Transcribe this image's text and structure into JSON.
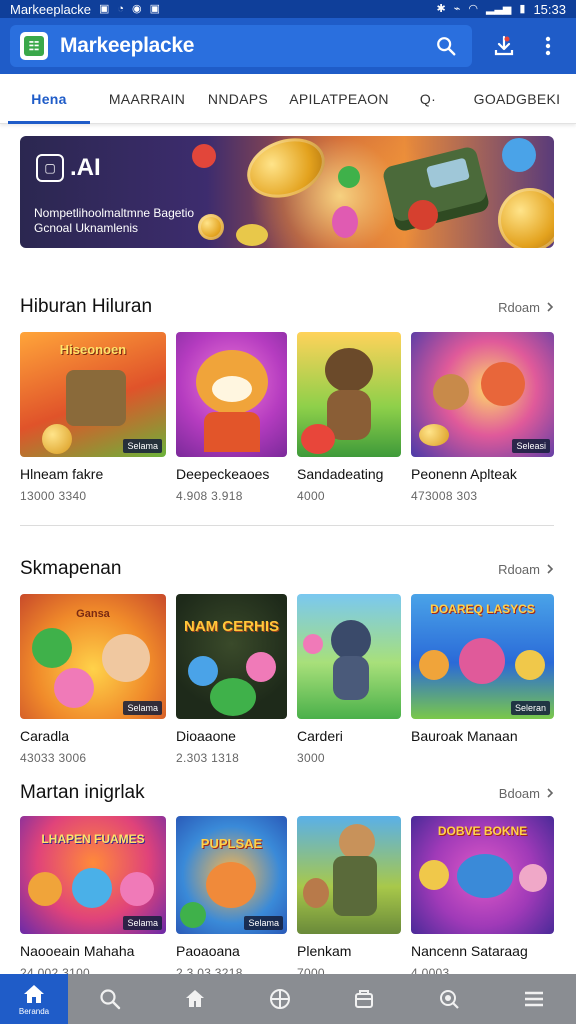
{
  "status_bar": {
    "app_name": "Markeeplacke",
    "time": "15:33"
  },
  "app_bar": {
    "logo_glyph": "☷",
    "title": "Markeeplacke"
  },
  "tabs": [
    {
      "label": "Hena",
      "active": true
    },
    {
      "label": "MAARRAIN",
      "active": false
    },
    {
      "label": "NNDAPS",
      "active": false
    },
    {
      "label": "APILATPEAON",
      "active": false
    },
    {
      "label": "Q·",
      "active": false
    },
    {
      "label": "GOADGBEKI",
      "active": false
    }
  ],
  "banner": {
    "logo_mark": "▢",
    "logo_text": ".AI",
    "line1": "Nompetlihoolmaltmne Bagetio",
    "line2": "Gcnoal Uknamlenis"
  },
  "sections": [
    {
      "title": "Hiburan Hiluran",
      "more_label": "Rdoam",
      "cards": [
        {
          "title": "Hlneam fakre",
          "meta": "13000 3340",
          "badge": "Selama",
          "thumb_text": "Hiseonoen"
        },
        {
          "title": "Deepeckeaoes",
          "meta": "4.908 3.918",
          "badge": "",
          "thumb_text": ""
        },
        {
          "title": "Sandadeating",
          "meta": "4000",
          "badge": "",
          "thumb_text": ""
        },
        {
          "title": "Peonenn Aplteak",
          "meta": "473008 303",
          "badge": "Seleasi",
          "thumb_text": ""
        }
      ]
    },
    {
      "title": "Skmapenan",
      "more_label": "Rdoam",
      "cards": [
        {
          "title": "Caradla",
          "meta": "43033 3006",
          "badge": "Selama",
          "thumb_text": "Gansa"
        },
        {
          "title": "Dioaaone",
          "meta": "2.303 1318",
          "badge": "",
          "thumb_text": "NAM CERHIS"
        },
        {
          "title": "Carderi",
          "meta": "3000",
          "badge": "",
          "thumb_text": ""
        },
        {
          "title": "Bauroak Manaan",
          "meta": "",
          "badge": "Seleran",
          "thumb_text": "DOAREQ LASYCS"
        }
      ]
    },
    {
      "title": "Martan inigrlak",
      "more_label": "Bdoam",
      "cards": [
        {
          "title": "Naooeain Mahaha",
          "meta": "24 002 3100",
          "badge": "Selama",
          "thumb_text": "LHAPEN FUAMES"
        },
        {
          "title": "Paoaoana",
          "meta": "2.3 03 3218",
          "badge": "Selama",
          "thumb_text": "PUPLSAE"
        },
        {
          "title": "Plenkam",
          "meta": "7000",
          "badge": "",
          "thumb_text": ""
        },
        {
          "title": "Nancenn Sataraag",
          "meta": "4 0003",
          "badge": "",
          "thumb_text": "DOBVE BOKNE"
        }
      ]
    }
  ],
  "bottom_nav": {
    "active_label": "Beranda",
    "items": [
      "home-icon",
      "search-icon",
      "house-icon",
      "compass-icon",
      "box-icon",
      "target-icon",
      "menu-icon"
    ]
  },
  "colors": {
    "primary": "#1f5cc8",
    "primary_dark": "#0f3f9a",
    "nav_bg": "#8a8d92"
  }
}
